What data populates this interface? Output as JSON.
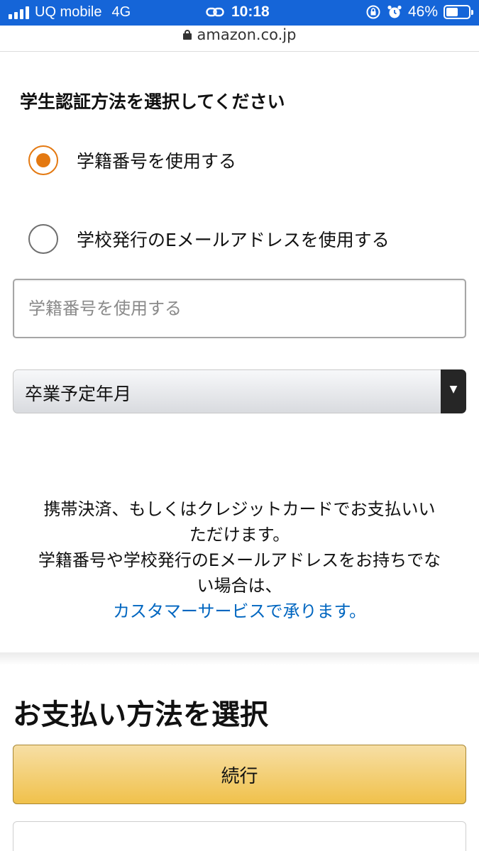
{
  "status_bar": {
    "carrier": "UQ mobile",
    "network": "4G",
    "time": "10:18",
    "battery": "46%",
    "battery_level": 0.46,
    "icons": [
      "signal-icon",
      "link-icon",
      "rotation-lock-icon",
      "alarm-icon",
      "battery-icon"
    ]
  },
  "browser": {
    "url": "amazon.co.jp"
  },
  "verification": {
    "heading": "学生認証方法を選択してください",
    "options": [
      {
        "label": "学籍番号を使用する",
        "selected": true
      },
      {
        "label": "学校発行のEメールアドレスを使用する",
        "selected": false
      }
    ],
    "input_placeholder": "学籍番号を使用する",
    "input_value": "",
    "graduation_select": "卒業予定年月"
  },
  "info": {
    "line1": "携帯決済、もしくはクレジットカードでお支払いい",
    "line2": "ただけます。",
    "line3": "学籍番号や学校発行のEメールアドレスをお持ちでな",
    "line4": "い場合は、",
    "link_text": "カスタマーサービスで承ります。"
  },
  "payment": {
    "heading": "お支払い方法を選択",
    "continue_label": "続行",
    "next_card_peek": ""
  },
  "colors": {
    "status_bar": "#1565d8",
    "radio_accent": "#e47911",
    "link": "#0066c0",
    "button_top": "#f7dfa5",
    "button_bottom": "#f0c14b"
  }
}
